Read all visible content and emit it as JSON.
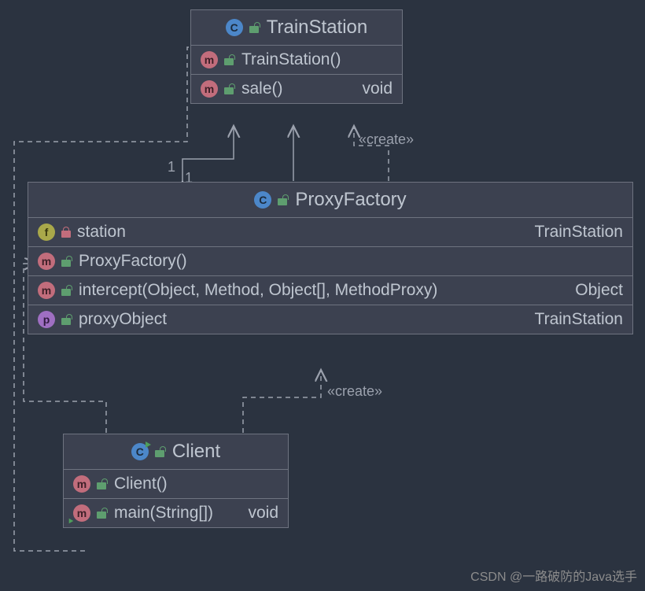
{
  "classes": {
    "trainStation": {
      "name": "TrainStation",
      "constructor": "TrainStation()",
      "method1": "sale()",
      "method1ret": "void"
    },
    "proxyFactory": {
      "name": "ProxyFactory",
      "field1": "station",
      "field1type": "TrainStation",
      "constructor": "ProxyFactory()",
      "method1": "intercept(Object, Method, Object[], MethodProxy)",
      "method1ret": "Object",
      "prop1": "proxyObject",
      "prop1type": "TrainStation"
    },
    "client": {
      "name": "Client",
      "constructor": "Client()",
      "method1": "main(String[])",
      "method1ret": "void"
    }
  },
  "relations": {
    "create1": "«create»",
    "create2": "«create»",
    "multiplicity1": "1",
    "multiplicity2": "1"
  },
  "watermark": "CSDN @一路破防的Java选手"
}
